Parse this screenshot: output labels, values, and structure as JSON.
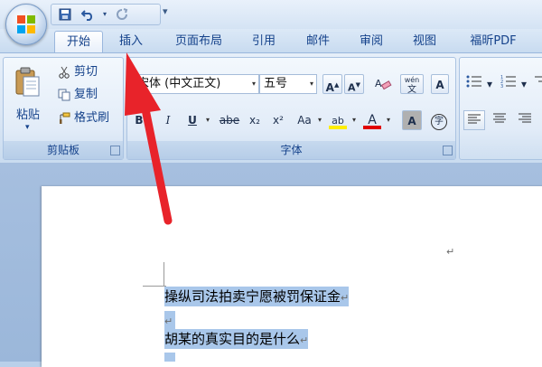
{
  "quick_access": {
    "save_icon": "save-icon",
    "undo_icon": "undo-icon",
    "redo_icon": "redo-icon",
    "customize_icon": "dropdown-arrow"
  },
  "tabs": [
    {
      "label": "开始",
      "active": true
    },
    {
      "label": "插入"
    },
    {
      "label": "页面布局"
    },
    {
      "label": "引用"
    },
    {
      "label": "邮件"
    },
    {
      "label": "审阅"
    },
    {
      "label": "视图"
    },
    {
      "label": "福昕PDF"
    }
  ],
  "clipboard": {
    "paste": "粘贴",
    "cut": "剪切",
    "copy": "复制",
    "format_painter": "格式刷",
    "group_label": "剪贴板"
  },
  "font": {
    "font_name": "宋体 (中文正文)",
    "font_size": "五号",
    "group_label": "字体",
    "buttons": {
      "bold": "B",
      "italic": "I",
      "underline": "U",
      "strike": "abe",
      "subscript": "x₂",
      "superscript": "x²",
      "change_case": "Aa",
      "highlight": "ab",
      "font_color": "A",
      "grow": "A",
      "shrink": "A",
      "phonetic": "wén",
      "border": "A",
      "char_shading": "A",
      "enclose": "字"
    }
  },
  "document": {
    "lines": [
      {
        "text": "操纵司法拍卖宁愿被罚保证金",
        "mark": "↵"
      },
      {
        "text": "",
        "mark": "↵"
      },
      {
        "text": "胡某的真实目的是什么",
        "mark": "↵"
      }
    ],
    "top_mark": "↵"
  },
  "colors": {
    "tab_text": "#15428b",
    "selection": "#a9c7ea",
    "arrow": "#e8232a",
    "highlight_yellow": "#ffee00",
    "font_red": "#e00000"
  }
}
